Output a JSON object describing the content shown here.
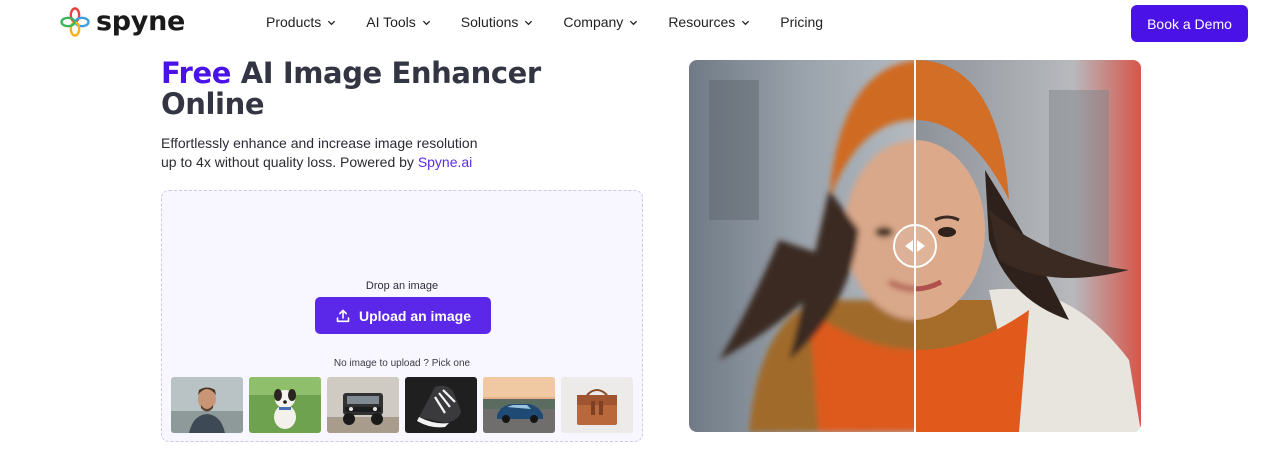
{
  "brand": {
    "name": "spyne"
  },
  "nav": {
    "items": [
      {
        "label": "Products",
        "dropdown": true
      },
      {
        "label": "AI Tools",
        "dropdown": true
      },
      {
        "label": "Solutions",
        "dropdown": true
      },
      {
        "label": "Company",
        "dropdown": true
      },
      {
        "label": "Resources",
        "dropdown": true
      },
      {
        "label": "Pricing",
        "dropdown": false
      }
    ],
    "cta_label": "Book a Demo"
  },
  "hero": {
    "title_accent": "Free",
    "title_rest": " AI Image Enhancer Online",
    "subtitle_text": "Effortlessly enhance and increase image resolution up to 4x without quality loss. Powered by ",
    "subtitle_link": "Spyne.ai"
  },
  "upload": {
    "drop_label": "Drop an image",
    "button_label": "Upload an image",
    "pick_label": "No image to upload ? Pick one",
    "samples": [
      "portrait",
      "dog",
      "jeep",
      "sneaker",
      "car",
      "handbag"
    ]
  },
  "colors": {
    "accent": "#4a12e6",
    "button": "#5b28ea",
    "dropzone_bg": "#f8f6ff"
  }
}
